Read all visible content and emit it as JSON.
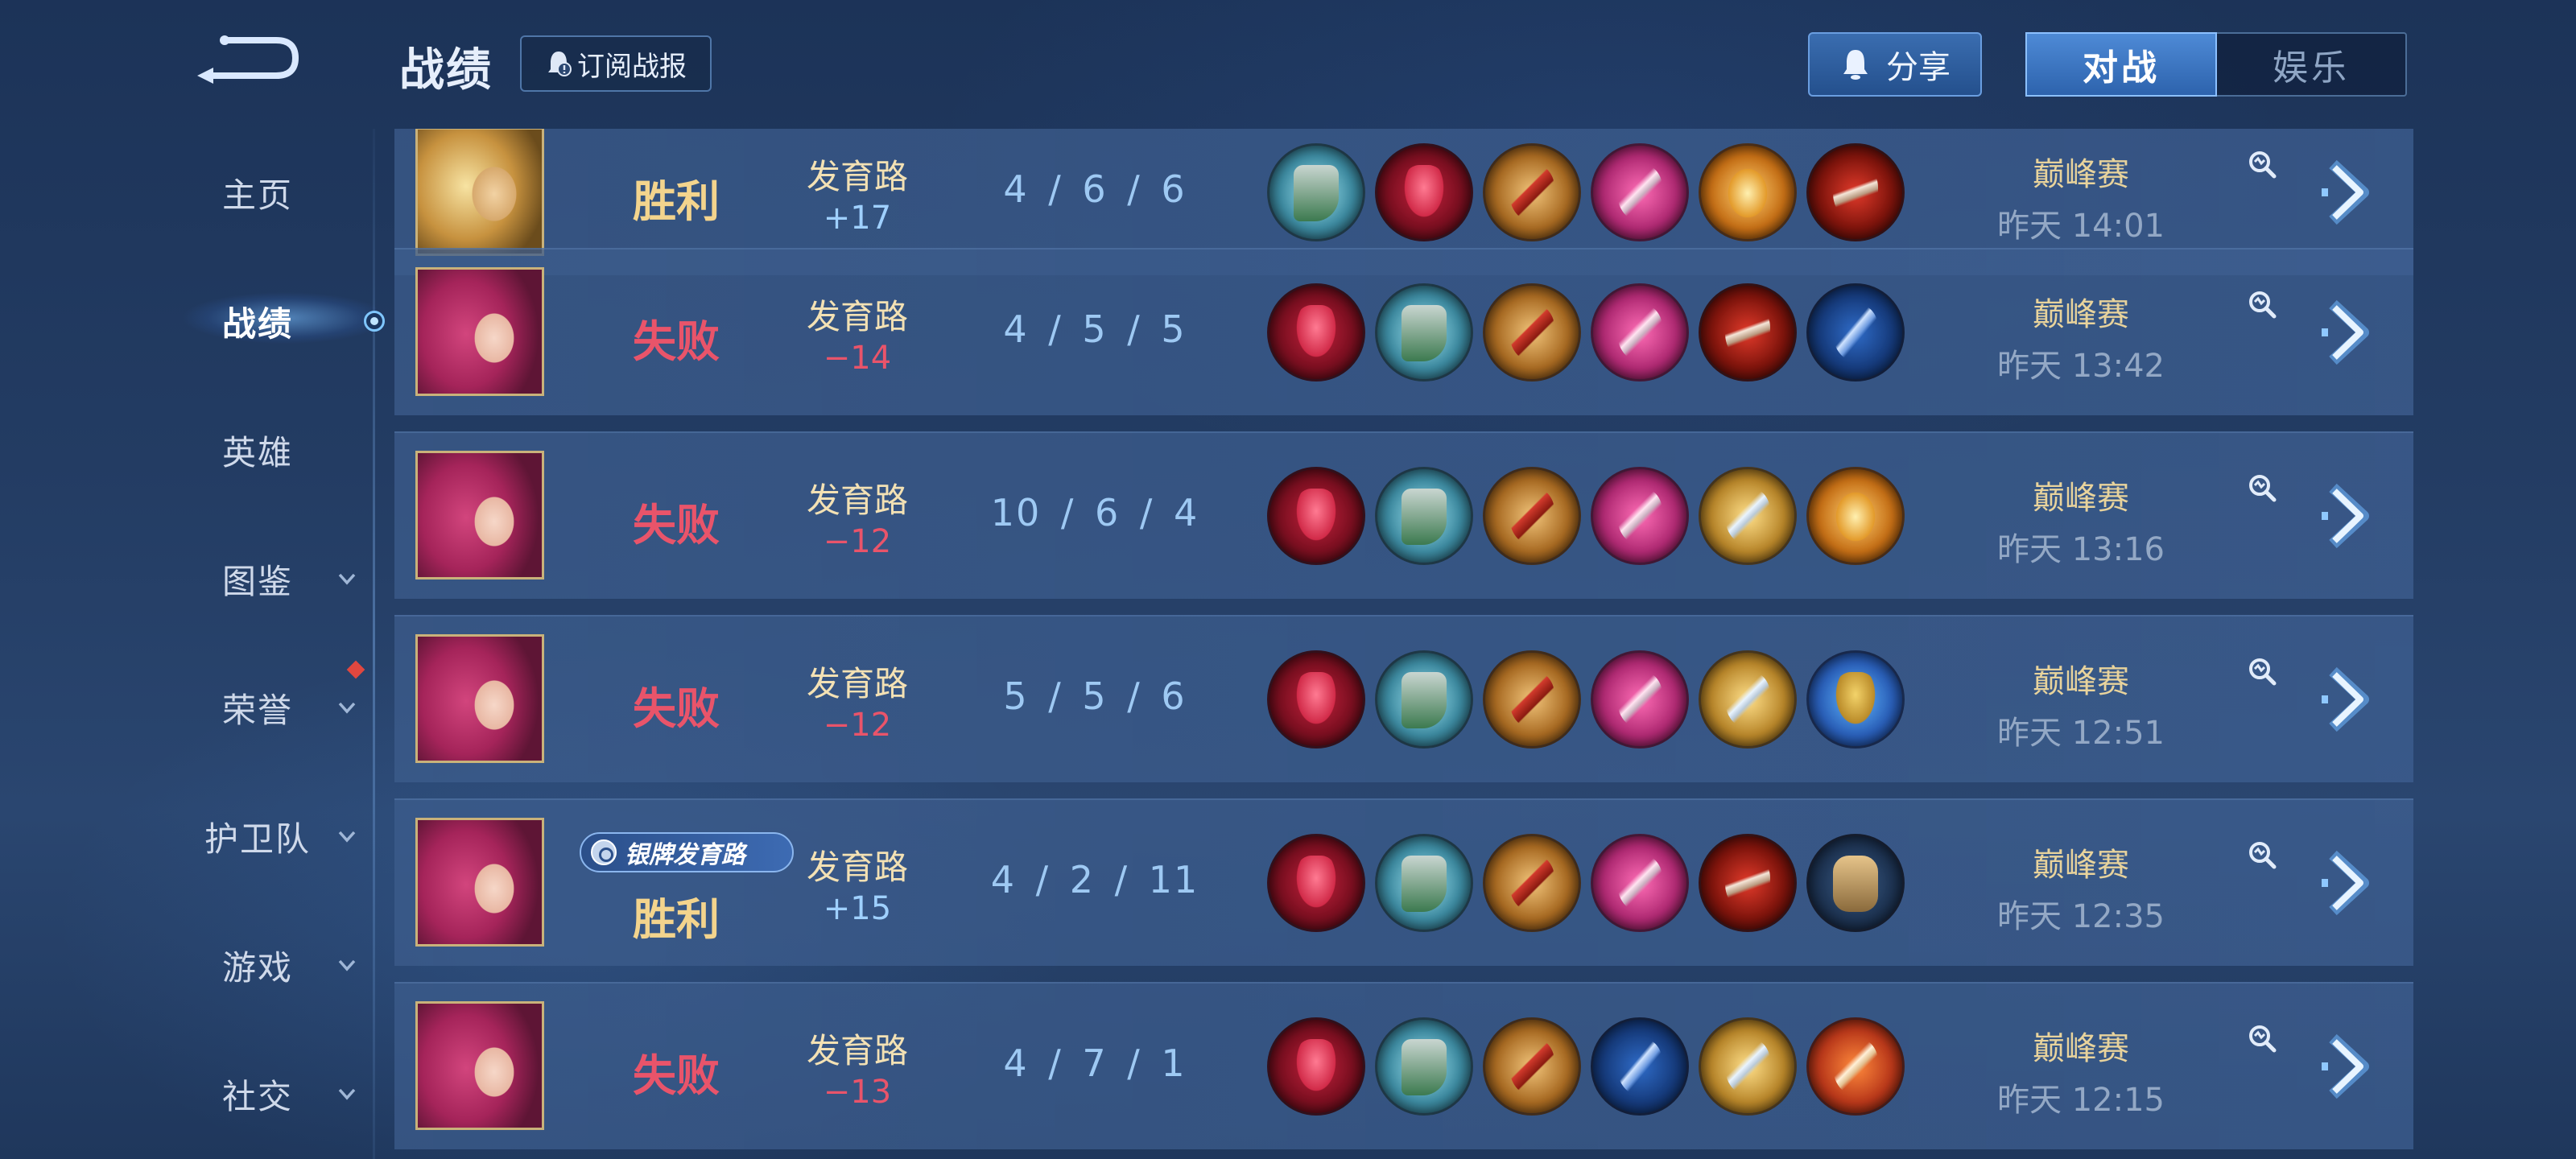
{
  "sidebar": {
    "items": [
      {
        "label": "主页",
        "has_chevron": false
      },
      {
        "label": "战绩",
        "has_chevron": false,
        "active": true
      },
      {
        "label": "英雄",
        "has_chevron": false
      },
      {
        "label": "图鉴",
        "has_chevron": true
      },
      {
        "label": "荣誉",
        "has_chevron": true,
        "notification": true
      },
      {
        "label": "护卫队",
        "has_chevron": true
      },
      {
        "label": "游戏",
        "has_chevron": true
      },
      {
        "label": "社交",
        "has_chevron": true
      }
    ]
  },
  "header": {
    "title": "战绩",
    "subscribe_label": "订阅战报",
    "share_label": "分享",
    "tabs": [
      {
        "label": "对战",
        "active": true
      },
      {
        "label": "娱乐",
        "active": false
      }
    ]
  },
  "matches": [
    {
      "result": "胜利",
      "result_type": "win",
      "hero": "gold",
      "lane": "发育路",
      "score": "+17",
      "kda": "4 / 6 / 6",
      "items": [
        "boots",
        "mask",
        "blade",
        "pink",
        "amber",
        "scythe"
      ],
      "mode": "巅峰赛",
      "time": "昨天 14:01"
    },
    {
      "result": "失败",
      "result_type": "loss",
      "hero": "pink",
      "lane": "发育路",
      "score": "−14",
      "kda": "4 / 5 / 5",
      "items": [
        "mask",
        "boots",
        "blade",
        "pink",
        "scythe",
        "bluebow"
      ],
      "mode": "巅峰赛",
      "time": "昨天 13:42"
    },
    {
      "result": "失败",
      "result_type": "loss",
      "hero": "pink",
      "lane": "发育路",
      "score": "−12",
      "kda": "10 / 6 / 4",
      "items": [
        "mask",
        "boots",
        "blade",
        "pink",
        "gold",
        "amber"
      ],
      "mode": "巅峰赛",
      "time": "昨天 13:16"
    },
    {
      "result": "失败",
      "result_type": "loss",
      "hero": "pink",
      "lane": "发育路",
      "score": "−12",
      "kda": "5 / 5 / 6",
      "items": [
        "mask",
        "boots",
        "blade",
        "pink",
        "gold",
        "armor"
      ],
      "mode": "巅峰赛",
      "time": "昨天 12:51"
    },
    {
      "result": "胜利",
      "result_type": "win",
      "hero": "pink",
      "badge": "银牌发育路",
      "lane": "发育路",
      "score": "+15",
      "kda": "4 / 2 / 11",
      "items": [
        "mask",
        "boots",
        "blade",
        "pink",
        "scythe",
        "gauntlet"
      ],
      "mode": "巅峰赛",
      "time": "昨天 12:35"
    },
    {
      "result": "失败",
      "result_type": "loss",
      "hero": "pink",
      "lane": "发育路",
      "score": "−13",
      "kda": "4 / 7 / 1",
      "items": [
        "mask",
        "boots",
        "blade",
        "bluebow",
        "gold",
        "orange"
      ],
      "mode": "巅峰赛",
      "time": "昨天 12:15"
    }
  ],
  "colors": {
    "win": "#f3d48d",
    "loss": "#e9546a",
    "score_positive": "#9fd0ff",
    "score_negative": "#e9546a",
    "accent_tab": "#2d63ad"
  }
}
